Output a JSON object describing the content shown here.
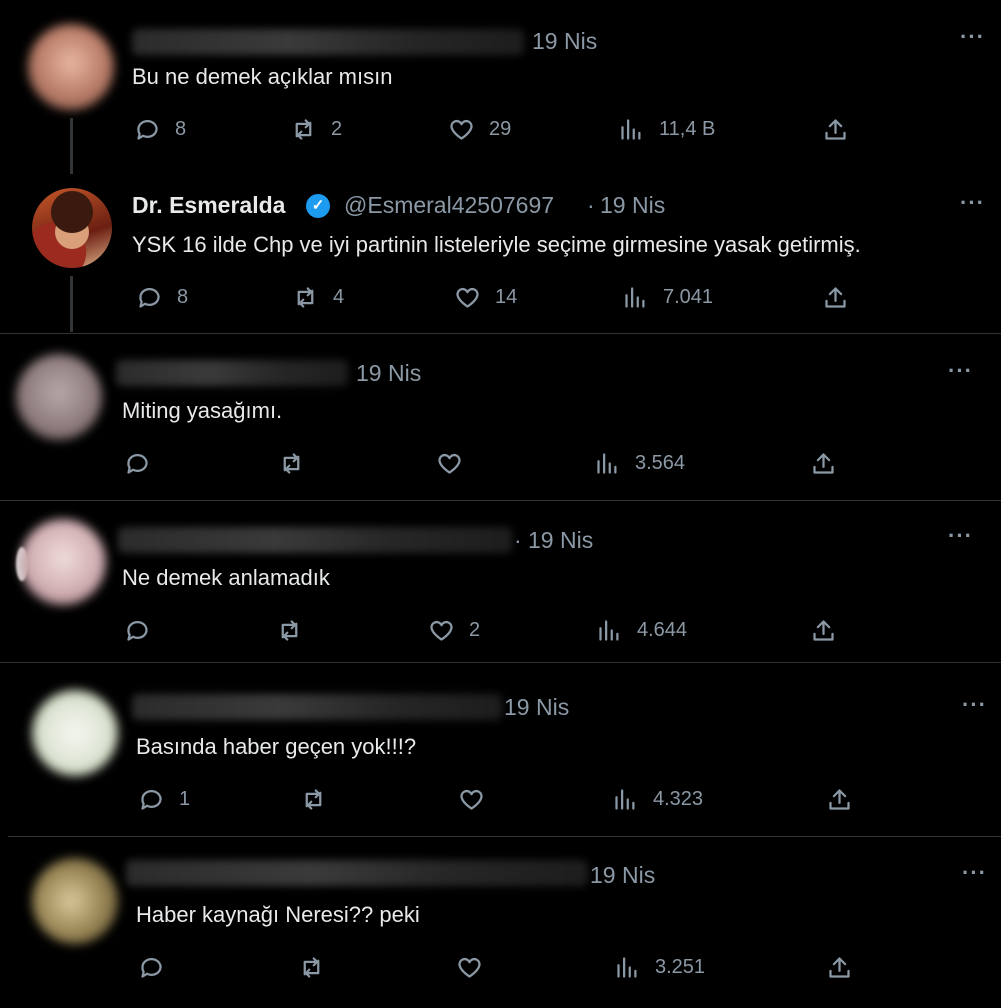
{
  "tweets": [
    {
      "id": "t1",
      "name_blurred": true,
      "date": "19 Nis",
      "text": "Bu ne demek açıklar mısın",
      "stats": {
        "replies": "8",
        "retweets": "2",
        "likes": "29",
        "views": "11,4 B"
      },
      "avatar_color": "#c98f7a"
    },
    {
      "id": "t2",
      "name": "Dr. Esmeralda",
      "verified": true,
      "handle": "@Esmeral42507697",
      "date_sep": "·",
      "date": "19 Nis",
      "text": "YSK 16 ilde Chp ve iyi partinin listeleriyle seçime girmesine yasak getirmiş.",
      "stats": {
        "replies": "8",
        "retweets": "4",
        "likes": "14",
        "views": "7.041"
      }
    },
    {
      "id": "t3",
      "name_blurred": true,
      "date": "19 Nis",
      "text": "Miting yasağımı.",
      "stats": {
        "replies": "",
        "retweets": "",
        "likes": "",
        "views": "3.564"
      },
      "avatar_color": "#9c8a8a"
    },
    {
      "id": "t4",
      "name_blurred": true,
      "date_sep": "·",
      "date": "19 Nis",
      "text": "Ne demek anlamadık",
      "stats": {
        "replies": "",
        "retweets": "",
        "likes": "2",
        "views": "4.644"
      },
      "avatar_color": "#d8b8bc"
    },
    {
      "id": "t5",
      "name_blurred": true,
      "date": "19 Nis",
      "text": "Basında haber geçen yok!!!?",
      "stats": {
        "replies": "1",
        "retweets": "",
        "likes": "",
        "views": "4.323"
      },
      "avatar_color": "#dfe7d8"
    },
    {
      "id": "t6",
      "name_blurred": true,
      "date": "19 Nis",
      "text": "Haber kaynağı Neresi??  peki",
      "stats": {
        "replies": "",
        "retweets": "",
        "likes": "",
        "views": "3.251"
      },
      "avatar_color": "#8a7a55"
    }
  ],
  "icons": {
    "reply": "reply-icon",
    "retweet": "retweet-icon",
    "like": "like-icon",
    "views": "views-icon",
    "share": "share-icon",
    "more": "more-icon",
    "verified": "verified-badge-icon"
  },
  "colors": {
    "background": "#000000",
    "text": "#e7e9ea",
    "muted": "#8b98a5",
    "verified": "#1d9bf0",
    "divider": "#2f3336"
  },
  "more_label": "···",
  "verified_glyph": "✓"
}
